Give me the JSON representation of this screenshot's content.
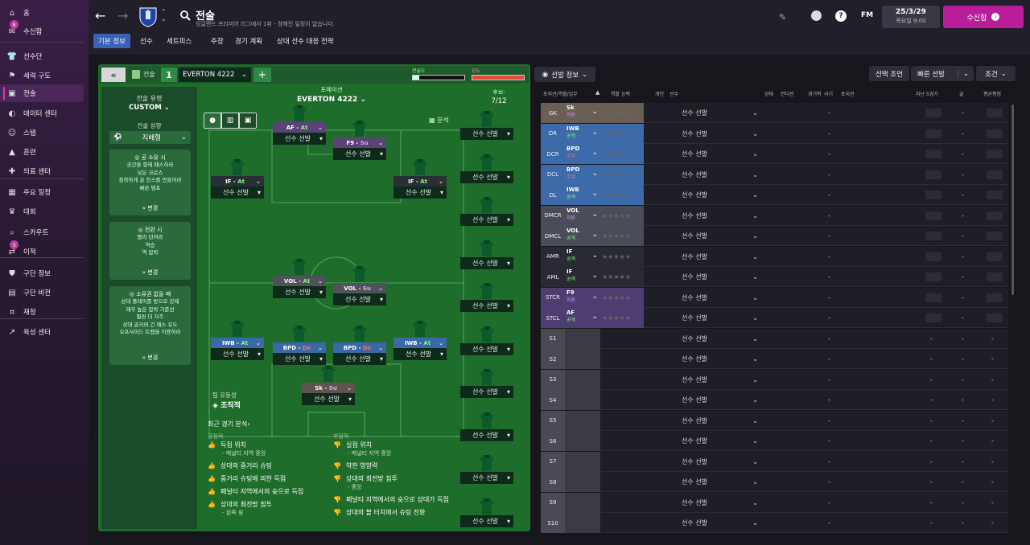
{
  "sidebar": {
    "items": [
      {
        "label": "홈",
        "icon": "home-icon"
      },
      {
        "label": "수신함",
        "icon": "inbox-icon",
        "badge": "9"
      },
      {
        "label": "선수단",
        "icon": "shirt-icon"
      },
      {
        "label": "세력 구도",
        "icon": "hierarchy-icon"
      },
      {
        "label": "전술",
        "icon": "tactics-icon"
      },
      {
        "label": "데이터 센터",
        "icon": "data-icon"
      },
      {
        "label": "스탭",
        "icon": "staff-icon"
      },
      {
        "label": "훈련",
        "icon": "training-icon"
      },
      {
        "label": "의료 센터",
        "icon": "medical-icon"
      },
      {
        "label": "주요 일정",
        "icon": "calendar-icon"
      },
      {
        "label": "대회",
        "icon": "trophy-icon"
      },
      {
        "label": "스카우트",
        "icon": "scout-icon"
      },
      {
        "label": "이적",
        "icon": "transfer-icon",
        "badge": "3"
      },
      {
        "label": "구단 정보",
        "icon": "club-icon"
      },
      {
        "label": "구단 비전",
        "icon": "vision-icon"
      },
      {
        "label": "재정",
        "icon": "finance-icon"
      },
      {
        "label": "육성 센터",
        "icon": "development-icon"
      }
    ]
  },
  "header": {
    "title": "전술",
    "subtitle": "잉글랜드 프리미어 리그에서 1위 - 정해진 일정이 없습니다.",
    "date": "25/3/29",
    "day_time": "목요일 9:00",
    "continue_label": "수신함",
    "fm_label": "FM"
  },
  "tabs": [
    "기본 정보",
    "선수",
    "세트피스",
    "주장",
    "경기 계획",
    "상대 선수 대응 전략"
  ],
  "tactic_bar": {
    "tactic_label": "전술",
    "slot": "1",
    "tactic_name": "EVERTON 4222",
    "familiarity_label": "전술도",
    "intensity_label": "강도"
  },
  "left_panel": {
    "style_label": "전술 유형",
    "style_value": "CUSTOM",
    "growth_label": "전술 성향",
    "growth_value": "지배형",
    "in_possession_title": "공 소유 시",
    "in_possession_lines": [
      "공간을 향해 패스하라",
      "낮은 크로스",
      "침착하게 골 찬스를 만들어라",
      "빠른 템포"
    ],
    "transition_title": "전환 시",
    "transition_lines": [
      "빨리 던져라",
      "역습",
      "역 압박"
    ],
    "out_possession_title": "소유권 없을 때",
    "out_possession_lines": [
      "상대 플레이를 방으로 강제",
      "매우 높은 압박 기준선",
      "훨씬 더 자주",
      "상대 골키퍼 긴 패스 유도",
      "오프사이드 트랩을 이용하라"
    ],
    "change_label": "변경"
  },
  "pitch": {
    "formation_label": "포메이션",
    "formation_name": "EVERTON 4222",
    "subs_label": "후보:",
    "subs_count": "7/12",
    "analysis_label": "분석",
    "fluidity_label": "팀 유동성",
    "fluidity_value": "조직적",
    "positions": [
      {
        "role": "AF",
        "duty": "At",
        "sel": "선수 선발"
      },
      {
        "role": "F9",
        "duty": "Su",
        "sel": "선수 선발"
      },
      {
        "role": "IF",
        "duty": "At",
        "sel": "선수 선발"
      },
      {
        "role": "IF",
        "duty": "At",
        "sel": "선수 선발"
      },
      {
        "role": "VOL",
        "duty": "At",
        "sel": "선수 선발"
      },
      {
        "role": "VOL",
        "duty": "Su",
        "sel": "선수 선발"
      },
      {
        "role": "IWB",
        "duty": "At",
        "sel": "선수 선발"
      },
      {
        "role": "BPD",
        "duty": "De",
        "sel": "선수 선발"
      },
      {
        "role": "BPD",
        "duty": "De",
        "sel": "선수 선발"
      },
      {
        "role": "IWB",
        "duty": "At",
        "sel": "선수 선발"
      },
      {
        "role": "Sk",
        "duty": "Su",
        "sel": "선수 선발"
      }
    ],
    "reserve_label": "선수 선발"
  },
  "analysis": {
    "title": "최근 경기 분석",
    "positive_label": "긍정적",
    "negative_label": "부정적",
    "positive": [
      {
        "t": "득점 위치",
        "s": "- 페널티 지역 중앙"
      },
      {
        "t": "상대의 중거리 슈팅",
        "s": ""
      },
      {
        "t": "중거리 슈팅에 의한 득점",
        "s": ""
      },
      {
        "t": "페널티 지역에서의 슛으로 득점",
        "s": ""
      },
      {
        "t": "상대의 최전방 침투",
        "s": "- 왼쪽 윙"
      }
    ],
    "negative": [
      {
        "t": "실점 위치",
        "s": "- 페널티 지역 중앙"
      },
      {
        "t": "약한 영향력",
        "s": ""
      },
      {
        "t": "상대의 최전방 침투",
        "s": "- 중앙"
      },
      {
        "t": "페널티 지역에서의 슛으로 상대가 득점",
        "s": ""
      },
      {
        "t": "상대의 볼 터치에서 슈팅 전환",
        "s": ""
      }
    ]
  },
  "right": {
    "dropdown_label": "선발 정보",
    "btn_select": "선택 조언",
    "btn_quick": "빠른 선발",
    "btn_cond": "조건",
    "headers": [
      "포지션/역할/임무",
      "역할 능력",
      "개인",
      "선수",
      "상태",
      "컨디션",
      "경기력",
      "사기",
      "포지션",
      "지난 5경기",
      "골",
      "평균평점"
    ],
    "rows": [
      {
        "pos": "GK",
        "role": "Sk",
        "duty": "지원",
        "color": "#6a5e55"
      },
      {
        "pos": "DR",
        "role": "IWB",
        "duty": "공격",
        "color": "#3d6aa8"
      },
      {
        "pos": "DCR",
        "role": "BPD",
        "duty": "수비",
        "color": "#3d6aa8"
      },
      {
        "pos": "DCL",
        "role": "BPD",
        "duty": "수비",
        "color": "#3d6aa8"
      },
      {
        "pos": "DL",
        "role": "IWB",
        "duty": "공격",
        "color": "#3d6aa8"
      },
      {
        "pos": "DMCR",
        "role": "VOL",
        "duty": "지원",
        "color": "#4a4d57"
      },
      {
        "pos": "DMCL",
        "role": "VOL",
        "duty": "공격",
        "color": "#4a4d57"
      },
      {
        "pos": "AMR",
        "role": "IF",
        "duty": "공격",
        "color": "#2a2a33"
      },
      {
        "pos": "AML",
        "role": "IF",
        "duty": "공격",
        "color": "#2a2a33"
      },
      {
        "pos": "STCR",
        "role": "F9",
        "duty": "지원",
        "color": "#4e3d70"
      },
      {
        "pos": "STCL",
        "role": "AF",
        "duty": "공격",
        "color": "#4e3d70"
      },
      {
        "pos": "S1"
      },
      {
        "pos": "S2"
      },
      {
        "pos": "S3"
      },
      {
        "pos": "S4"
      },
      {
        "pos": "S5"
      },
      {
        "pos": "S6"
      },
      {
        "pos": "S7"
      },
      {
        "pos": "S8"
      },
      {
        "pos": "S9"
      },
      {
        "pos": "S10"
      }
    ],
    "player_label": "선수 선발",
    "dash": "-"
  }
}
